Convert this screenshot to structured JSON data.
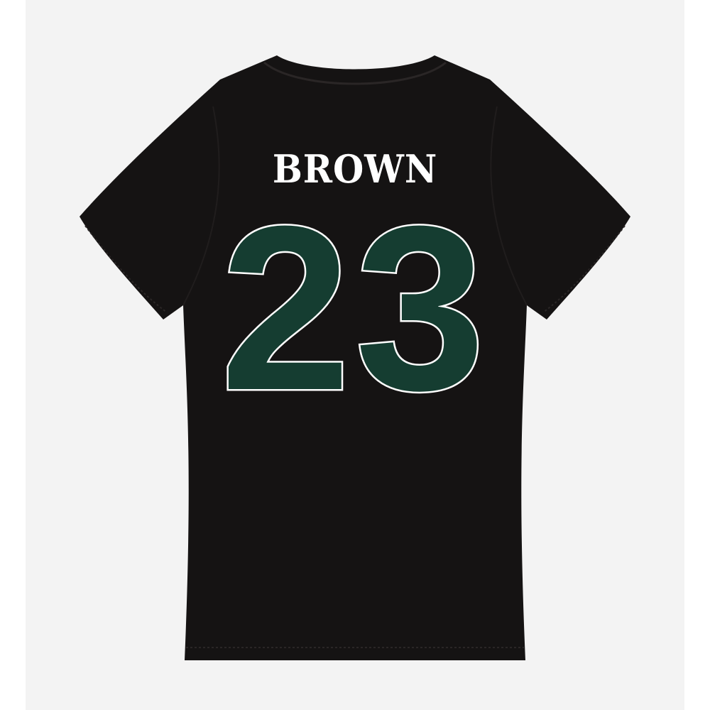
{
  "product": {
    "player_name": "BROWN",
    "player_number": "23"
  },
  "colors": {
    "shirt": "#151313",
    "number_fill": "#153d31",
    "number_outline": "#ffffff",
    "name_text": "#ffffff",
    "background": "#f3f3f3"
  }
}
